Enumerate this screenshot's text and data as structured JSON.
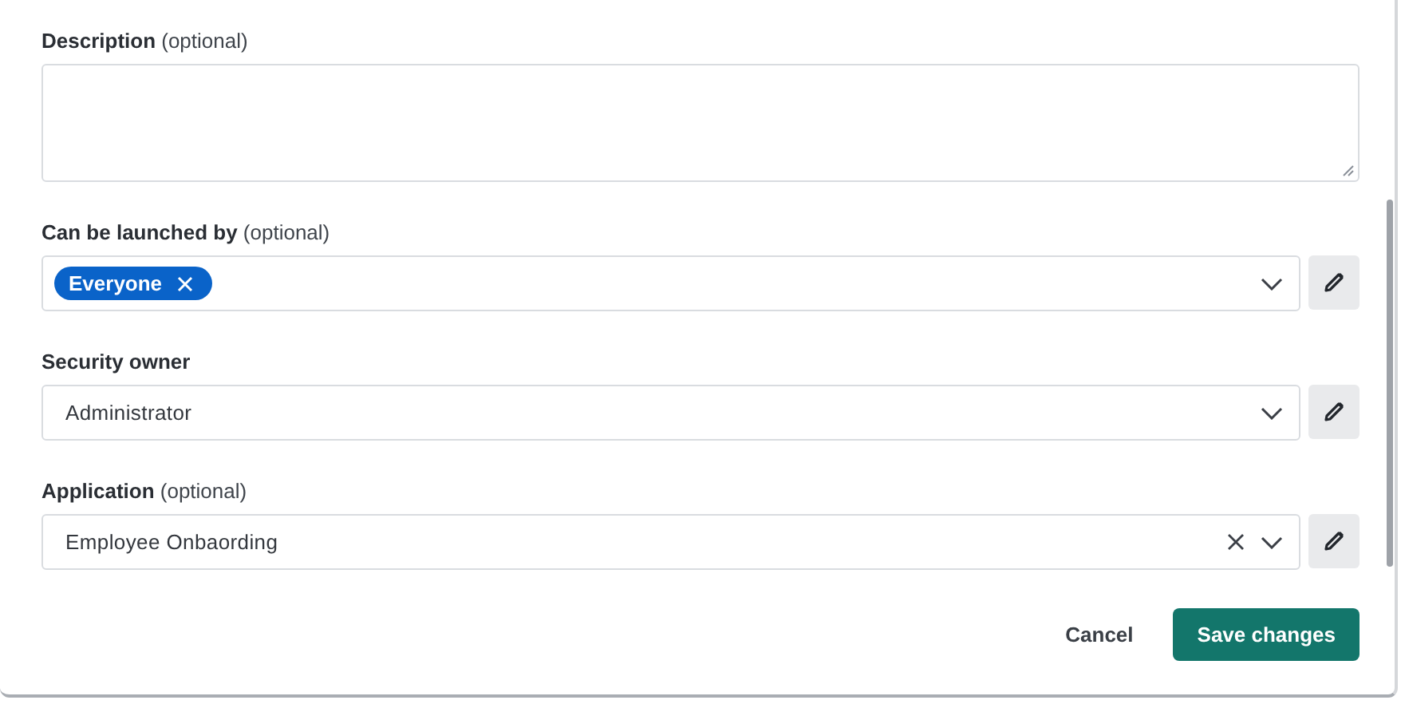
{
  "fields": [
    {
      "kind": "textarea",
      "label": "**Description** (optional)"
    },
    {
      "kind": "multiselect",
      "label": "**Can be launched by** (optional)",
      "tags": [
        "Everyone"
      ],
      "clearable": false
    },
    {
      "kind": "select",
      "label": "**Security owner**",
      "value": "Administrator",
      "clearable": false
    },
    {
      "kind": "select",
      "label": "**Application** (optional)",
      "value": "Employee Onbaording",
      "clearable": true
    }
  ],
  "buttons": {
    "cancel": "Cancel",
    "save": "Save changes"
  }
}
